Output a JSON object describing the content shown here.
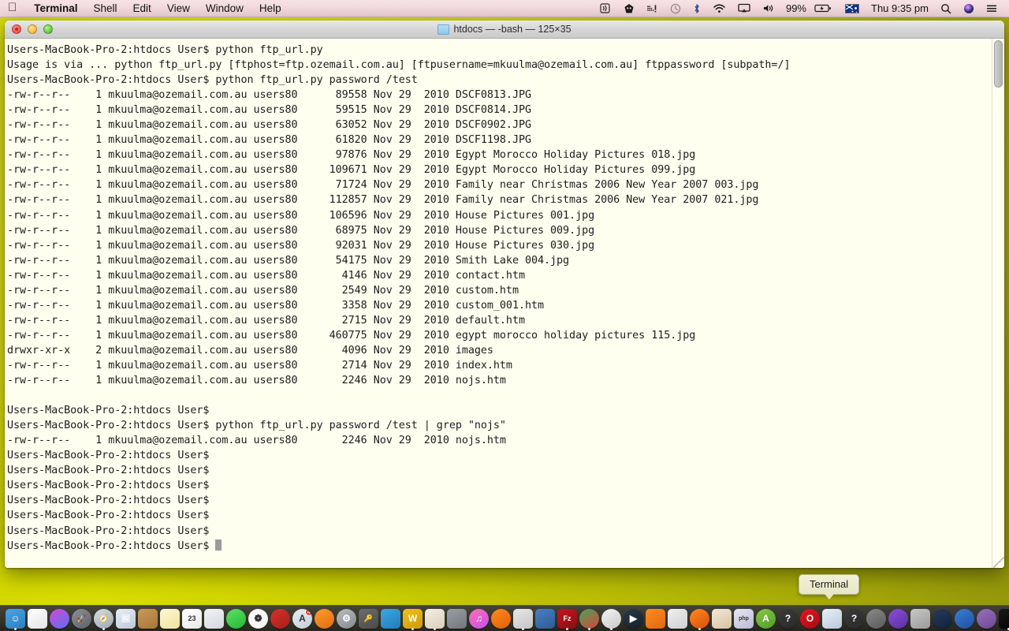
{
  "menubar": {
    "apple_icon": "apple-logo",
    "items": [
      {
        "label": "Terminal",
        "bold": true
      },
      {
        "label": "Shell",
        "bold": false
      },
      {
        "label": "Edit",
        "bold": false
      },
      {
        "label": "View",
        "bold": false
      },
      {
        "label": "Window",
        "bold": false
      },
      {
        "label": "Help",
        "bold": false
      }
    ],
    "status": {
      "battery_percent": "99%",
      "clock": "Thu 9:35 pm",
      "icons": [
        "airplay-audio-icon",
        "avast-icon",
        "dots-icon",
        "time-machine-icon",
        "bluetooth-icon",
        "wifi-icon",
        "airplay-display-icon",
        "volume-icon",
        "battery-icon",
        "flag-australia-icon",
        "spotlight-search-icon",
        "siri-icon",
        "notification-center-icon"
      ]
    }
  },
  "window": {
    "title": "htdocs — -bash — 125×35",
    "title_icon": "folder-icon",
    "buttons": {
      "close": "close-button",
      "minimize": "minimize-button",
      "zoom": "zoom-button"
    }
  },
  "terminal": {
    "prompt": "Users-MacBook-Pro-2:htdocs User$",
    "lines": [
      "Users-MacBook-Pro-2:htdocs User$ python ftp_url.py",
      "Usage is via ... python ftp_url.py [ftphost=ftp.ozemail.com.au] [ftpusername=mkuulma@ozemail.com.au] ftppassword [subpath=/]",
      "Users-MacBook-Pro-2:htdocs User$ python ftp_url.py password /test",
      "-rw-r--r--    1 mkuulma@ozemail.com.au users80      89558 Nov 29  2010 DSCF0813.JPG",
      "-rw-r--r--    1 mkuulma@ozemail.com.au users80      59515 Nov 29  2010 DSCF0814.JPG",
      "-rw-r--r--    1 mkuulma@ozemail.com.au users80      63052 Nov 29  2010 DSCF0902.JPG",
      "-rw-r--r--    1 mkuulma@ozemail.com.au users80      61820 Nov 29  2010 DSCF1198.JPG",
      "-rw-r--r--    1 mkuulma@ozemail.com.au users80      97876 Nov 29  2010 Egypt Morocco Holiday Pictures 018.jpg",
      "-rw-r--r--    1 mkuulma@ozemail.com.au users80     109671 Nov 29  2010 Egypt Morocco Holiday Pictures 099.jpg",
      "-rw-r--r--    1 mkuulma@ozemail.com.au users80      71724 Nov 29  2010 Family near Christmas 2006 New Year 2007 003.jpg",
      "-rw-r--r--    1 mkuulma@ozemail.com.au users80     112857 Nov 29  2010 Family near Christmas 2006 New Year 2007 021.jpg",
      "-rw-r--r--    1 mkuulma@ozemail.com.au users80     106596 Nov 29  2010 House Pictures 001.jpg",
      "-rw-r--r--    1 mkuulma@ozemail.com.au users80      68975 Nov 29  2010 House Pictures 009.jpg",
      "-rw-r--r--    1 mkuulma@ozemail.com.au users80      92031 Nov 29  2010 House Pictures 030.jpg",
      "-rw-r--r--    1 mkuulma@ozemail.com.au users80      54175 Nov 29  2010 Smith Lake 004.jpg",
      "-rw-r--r--    1 mkuulma@ozemail.com.au users80       4146 Nov 29  2010 contact.htm",
      "-rw-r--r--    1 mkuulma@ozemail.com.au users80       2549 Nov 29  2010 custom.htm",
      "-rw-r--r--    1 mkuulma@ozemail.com.au users80       3358 Nov 29  2010 custom_001.htm",
      "-rw-r--r--    1 mkuulma@ozemail.com.au users80       2715 Nov 29  2010 default.htm",
      "-rw-r--r--    1 mkuulma@ozemail.com.au users80     460775 Nov 29  2010 egypt morocco holiday pictures 115.jpg",
      "drwxr-xr-x    2 mkuulma@ozemail.com.au users80       4096 Nov 29  2010 images",
      "-rw-r--r--    1 mkuulma@ozemail.com.au users80       2714 Nov 29  2010 index.htm",
      "-rw-r--r--    1 mkuulma@ozemail.com.au users80       2246 Nov 29  2010 nojs.htm",
      "",
      "Users-MacBook-Pro-2:htdocs User$",
      "Users-MacBook-Pro-2:htdocs User$ python ftp_url.py password /test | grep \"nojs\"",
      "-rw-r--r--    1 mkuulma@ozemail.com.au users80       2246 Nov 29  2010 nojs.htm",
      "Users-MacBook-Pro-2:htdocs User$",
      "Users-MacBook-Pro-2:htdocs User$",
      "Users-MacBook-Pro-2:htdocs User$",
      "Users-MacBook-Pro-2:htdocs User$",
      "Users-MacBook-Pro-2:htdocs User$",
      "Users-MacBook-Pro-2:htdocs User$"
    ],
    "last_line": "Users-MacBook-Pro-2:htdocs User$ ",
    "colors": {
      "background": "#fffff0",
      "foreground": "#1c1c1c",
      "cursor": "#9b9b9b"
    }
  },
  "tooltip": {
    "label": "Terminal"
  },
  "dock": {
    "items": [
      {
        "name": "finder",
        "color1": "#4ea3e0",
        "color2": "#2a7ec0",
        "glyph": "☺",
        "running": true
      },
      {
        "name": "document",
        "color1": "#ffffff",
        "color2": "#e4e4e4",
        "glyph": "",
        "running": false
      },
      {
        "name": "siri",
        "color1": "#cf4bd6",
        "color2": "#5b6ff0",
        "glyph": "",
        "running": false
      },
      {
        "name": "launchpad",
        "color1": "#8a9096",
        "color2": "#5c6268",
        "glyph": "🚀",
        "running": false
      },
      {
        "name": "safari",
        "color1": "#d8dee4",
        "color2": "#9aa6b2",
        "glyph": "🧭",
        "running": true
      },
      {
        "name": "preview",
        "color1": "#e8eef6",
        "color2": "#b9c8da",
        "glyph": "🖼",
        "running": false
      },
      {
        "name": "folder",
        "color1": "#c89a5a",
        "color2": "#a8763a",
        "glyph": "",
        "running": false
      },
      {
        "name": "notes",
        "color1": "#fdf8d8",
        "color2": "#f0e39a",
        "glyph": "",
        "running": false
      },
      {
        "name": "calendar",
        "color1": "#ffffff",
        "color2": "#e8e8e8",
        "glyph": "23",
        "running": false
      },
      {
        "name": "app-store-tools",
        "color1": "#f4f4f4",
        "color2": "#cfd8e0",
        "glyph": "",
        "running": false
      },
      {
        "name": "messages",
        "color1": "#5fe06a",
        "color2": "#22b832",
        "glyph": "",
        "running": false
      },
      {
        "name": "photos",
        "color1": "#ffffff",
        "color2": "#f0f0f0",
        "glyph": "❁",
        "running": false
      },
      {
        "name": "red-app",
        "color1": "#d8322c",
        "color2": "#a51f1a",
        "glyph": "",
        "running": false
      },
      {
        "name": "app-store",
        "color1": "#e8edf2",
        "color2": "#c3ccd6",
        "glyph": "A",
        "running": false,
        "badge": "4"
      },
      {
        "name": "ibooks",
        "color1": "#ff9b2e",
        "color2": "#e06d10",
        "glyph": "",
        "running": false
      },
      {
        "name": "system-preferences",
        "color1": "#b8bcc0",
        "color2": "#85898d",
        "glyph": "⚙",
        "running": false
      },
      {
        "name": "keychain",
        "color1": "#6d6d6d",
        "color2": "#4a4a4a",
        "glyph": "🔑",
        "running": false
      },
      {
        "name": "bucket",
        "color1": "#3fa8e0",
        "color2": "#1f7db8",
        "glyph": "",
        "running": false
      },
      {
        "name": "wordpress",
        "color1": "#f0c020",
        "color2": "#d09a08",
        "glyph": "W",
        "running": true
      },
      {
        "name": "paint-app",
        "color1": "#f4efe4",
        "color2": "#d8cfbc",
        "glyph": "",
        "running": true
      },
      {
        "name": "radio",
        "color1": "#9aa0a6",
        "color2": "#70767c",
        "glyph": "",
        "running": false
      },
      {
        "name": "itunes",
        "color1": "#ff6fae",
        "color2": "#c74ef0",
        "glyph": "♫",
        "running": false
      },
      {
        "name": "avast",
        "color1": "#ff8a1f",
        "color2": "#e05f08",
        "glyph": "",
        "running": false
      },
      {
        "name": "utility-app",
        "color1": "#e8e8e8",
        "color2": "#c4c4c4",
        "glyph": "",
        "running": true
      },
      {
        "name": "screens",
        "color1": "#4a7fc0",
        "color2": "#2c5c98",
        "glyph": "",
        "running": false
      },
      {
        "name": "filezilla",
        "color1": "#c0171e",
        "color2": "#8c0d12",
        "glyph": "Fz",
        "running": true
      },
      {
        "name": "chrome",
        "color1": "#4aa354",
        "color2": "#d8453c",
        "glyph": "",
        "running": true
      },
      {
        "name": "ghost-app",
        "color1": "#f4f4f4",
        "color2": "#c8c8c8",
        "glyph": "",
        "running": true
      },
      {
        "name": "quicktime",
        "color1": "#2a3a4a",
        "color2": "#151f2a",
        "glyph": "▶",
        "running": false
      },
      {
        "name": "vlc",
        "color1": "#ff8d20",
        "color2": "#e06810",
        "glyph": "",
        "running": false
      },
      {
        "name": "virtualbox-box",
        "color1": "#f0f0f0",
        "color2": "#cfcfcf",
        "glyph": "",
        "running": false
      },
      {
        "name": "firefox",
        "color1": "#ff8a1f",
        "color2": "#d84e0a",
        "glyph": "",
        "running": true
      },
      {
        "name": "contacts",
        "color1": "#f4e8d8",
        "color2": "#d8c2a0",
        "glyph": "",
        "running": false
      },
      {
        "name": "php",
        "color1": "#e8e8f4",
        "color2": "#b8b8d4",
        "glyph": "php",
        "running": false
      },
      {
        "name": "android-studio",
        "color1": "#8ec63f",
        "color2": "#4a9f2f",
        "glyph": "A",
        "running": false
      },
      {
        "name": "help",
        "color1": "#3a3a3a",
        "color2": "#2a2a2a",
        "glyph": "?",
        "running": false
      },
      {
        "name": "opera",
        "color1": "#e8141e",
        "color2": "#a50c14",
        "glyph": "O",
        "running": false
      },
      {
        "name": "virtualbox",
        "color1": "#e8f0f8",
        "color2": "#b8c8d8",
        "glyph": "",
        "running": false
      },
      {
        "name": "help-2",
        "color1": "#3a3a3a",
        "color2": "#2a2a2a",
        "glyph": "?",
        "running": false
      },
      {
        "name": "spider-app",
        "color1": "#8a8a8a",
        "color2": "#5a5a5a",
        "glyph": "",
        "running": false
      },
      {
        "name": "visual-studio",
        "color1": "#8a4fd8",
        "color2": "#5c2fa0",
        "glyph": "",
        "running": false
      },
      {
        "name": "scanner",
        "color1": "#c8c8c8",
        "color2": "#9a9a9a",
        "glyph": "",
        "running": false
      },
      {
        "name": "globe-app",
        "color1": "#2a3a5a",
        "color2": "#12203a",
        "glyph": "",
        "running": false
      },
      {
        "name": "sequel-pro",
        "color1": "#3a7fd8",
        "color2": "#1f4f9f",
        "glyph": "",
        "running": false
      },
      {
        "name": "github",
        "color1": "#9a6fc0",
        "color2": "#6c4a90",
        "glyph": "",
        "running": false
      },
      {
        "name": "terminal",
        "color1": "#1a1a1a",
        "color2": "#000000",
        "glyph": "",
        "running": true
      },
      {
        "name": "balls-app",
        "color1": "#e8e848",
        "color2": "#3a8fd8",
        "glyph": "",
        "running": false
      },
      {
        "name": "droplet-app",
        "color1": "#f8f8f8",
        "color2": "#d0d0d0",
        "glyph": "",
        "running": false
      },
      {
        "name": "image-capture",
        "color1": "#f4f4f4",
        "color2": "#d4d4d4",
        "glyph": "",
        "running": false
      },
      {
        "name": "blue-folder",
        "color1": "#4aa8e8",
        "color2": "#2878b8",
        "glyph": "",
        "running": false
      },
      {
        "name": "key-app",
        "color1": "#f0c838",
        "color2": "#d09a10",
        "glyph": "",
        "running": false
      }
    ],
    "stacks": [
      {
        "name": "documents-stack",
        "color1": "#f4f4f4",
        "color2": "#d0d0d0"
      },
      {
        "name": "downloads-stack",
        "color1": "#e0ecf8",
        "color2": "#b4c8e0"
      }
    ],
    "trash": {
      "name": "trash",
      "color1": "#eaeaea",
      "color2": "#bcbcbc"
    }
  }
}
